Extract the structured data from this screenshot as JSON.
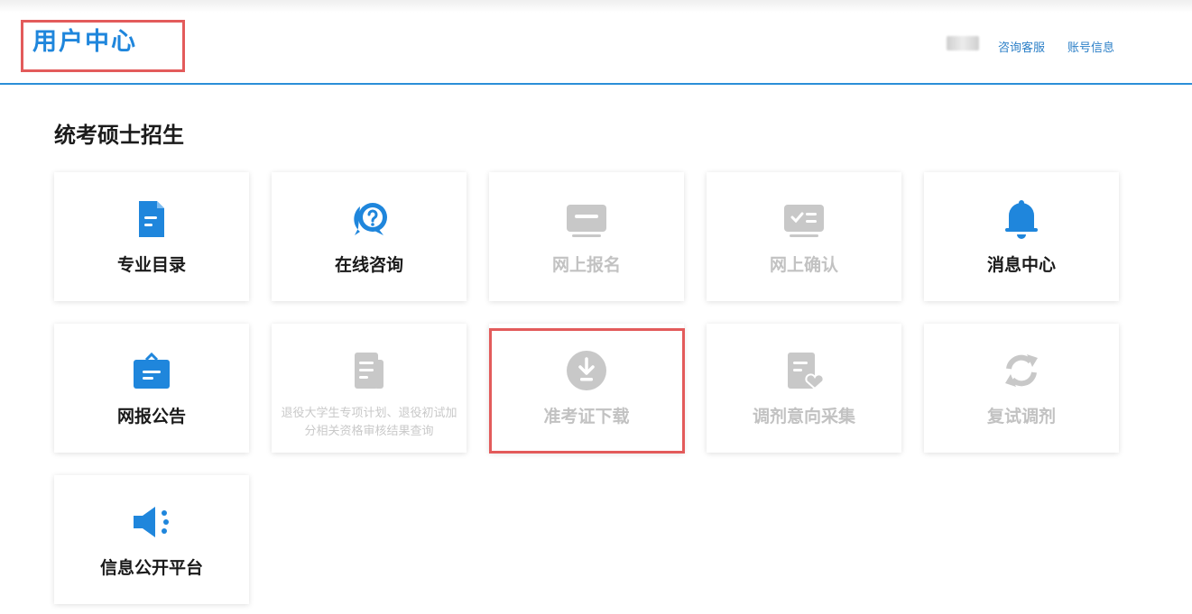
{
  "header": {
    "title": "用户中心",
    "links": {
      "consult": "咨询客服",
      "account": "账号信息"
    }
  },
  "section": {
    "title": "统考硕士招生"
  },
  "cards": {
    "major_catalog": {
      "label": "专业目录",
      "icon": "document-icon",
      "enabled": true
    },
    "online_consult": {
      "label": "在线咨询",
      "icon": "question-bubble-icon",
      "enabled": true
    },
    "online_register": {
      "label": "网上报名",
      "icon": "id-card-icon",
      "enabled": false
    },
    "online_confirm": {
      "label": "网上确认",
      "icon": "confirm-card-icon",
      "enabled": false
    },
    "message_center": {
      "label": "消息中心",
      "icon": "bell-icon",
      "enabled": true
    },
    "announcement": {
      "label": "网报公告",
      "icon": "briefcase-icon",
      "enabled": true
    },
    "veteran_query": {
      "label": "退役大学生专项计划、退役初试加分相关资格审核结果查询",
      "icon": "document-list-icon",
      "enabled": false
    },
    "admission_ticket": {
      "label": "准考证下载",
      "icon": "download-icon",
      "enabled": false
    },
    "transfer_intent": {
      "label": "调剂意向采集",
      "icon": "document-heart-icon",
      "enabled": false
    },
    "retest_transfer": {
      "label": "复试调剂",
      "icon": "refresh-icon",
      "enabled": false
    },
    "info_platform": {
      "label": "信息公开平台",
      "icon": "megaphone-icon",
      "enabled": true
    }
  },
  "colors": {
    "accent": "#1f86dc",
    "highlight": "#e35b5b",
    "disabled": "#c2c2c2"
  }
}
